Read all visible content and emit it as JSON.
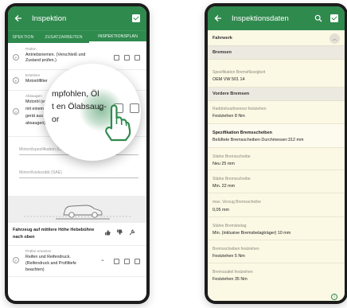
{
  "left_phone": {
    "appbar": {
      "title": "Inspektion",
      "back_icon": "arrow-left-icon",
      "action_icon": "checkbox-checked-icon"
    },
    "tabs": [
      "SPEKTION",
      "ZUSATZARBEITEN",
      "INSPEKTIONSPLAN"
    ],
    "items": [
      {
        "category": "Prüfen",
        "text_line1": "Antriebsriemen. (Verschleiß und",
        "text_line2": "Zustand prüfen.)"
      },
      {
        "category": "Ersetzen",
        "text_line1": "Motorölfilter"
      },
      {
        "category": "Absaugen",
        "text_line1": "Motoröl (es w",
        "text_line2": "mit einem g",
        "text_line3": "gerät aus de",
        "text_line4": "absaugen)."
      }
    ],
    "fields": [
      {
        "placeholder": "Motorölspezifikation (O..."
      },
      {
        "placeholder": "Motorölviskosität (SAE)"
      }
    ],
    "car_section": {
      "title_line1": "Fahrzeug auf mittlere Höhe Hebebühne",
      "title_line2": "nach oben"
    },
    "last_item": {
      "category": "Prüfen ersetzen",
      "text_line1": "Reifen und Reifendruck.",
      "text_line2": "(Reifendruck and Profiltiefe",
      "text_line3": "beachten)"
    },
    "magnifier": {
      "line1": "mpfohlen, Öl",
      "line2": "t en Ölabsaug-",
      "line3": "or"
    }
  },
  "right_phone": {
    "appbar": {
      "title": "Inspektionsdaten",
      "back_icon": "arrow-left-icon",
      "search_icon": "search-icon",
      "action_icon": "checkbox-checked-icon"
    },
    "section": "Fahrwerk",
    "group1": "Bremsen",
    "items1": [
      {
        "label": "Spezifikation Bremsflüssigkeit",
        "value": "OEM VW 501 14"
      }
    ],
    "group2": "Vordere Bremsen",
    "items2": [
      {
        "label": "Raddrehzahlsensor festziehen",
        "value": "Festziehen 8 Nm"
      },
      {
        "label": "Spezifikation Bremsscheiben",
        "value": "Belüftete Bremsscheiben Durchmesser:312 mm",
        "bold_label": true
      },
      {
        "label": "Stärke Bremsscheibe",
        "value": "Neu 25 mm"
      },
      {
        "label": "Stärke Bremsscheibe",
        "value": "Min. 22 mm"
      },
      {
        "label": "max. Verzug Bremsscheibe",
        "value": "0,05 mm"
      },
      {
        "label": "Stärke Bremsbelag",
        "value": "Min. (inklusive Bremsbelagträger) 10 mm"
      },
      {
        "label": "Bremsscheiben festziehen",
        "value": "Festziehen 5 Nm"
      },
      {
        "label": "Bremssattel festziehen",
        "value": "Festziehen 35 Nm"
      }
    ]
  },
  "colors": {
    "primary": "#2f8a4e",
    "cream": "#fbf8e4"
  }
}
